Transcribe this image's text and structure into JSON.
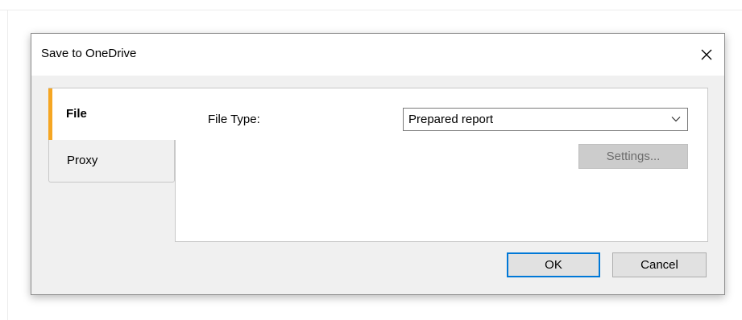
{
  "dialog": {
    "title": "Save to OneDrive",
    "close_glyph": "×"
  },
  "tabs": [
    {
      "label": "File",
      "selected": true,
      "accent": "#f5a623"
    },
    {
      "label": "Proxy",
      "selected": false
    }
  ],
  "file_panel": {
    "file_type_label": "File Type:",
    "file_type_value": "Prepared report",
    "settings_label": "Settings...",
    "settings_enabled": false
  },
  "buttons": {
    "ok_label": "OK",
    "cancel_label": "Cancel"
  },
  "colors": {
    "focus_border": "#0078d7",
    "dialog_bg": "#f0f0f0"
  },
  "icons": {
    "close": "close-icon",
    "dropdown": "chevron-down-icon"
  }
}
